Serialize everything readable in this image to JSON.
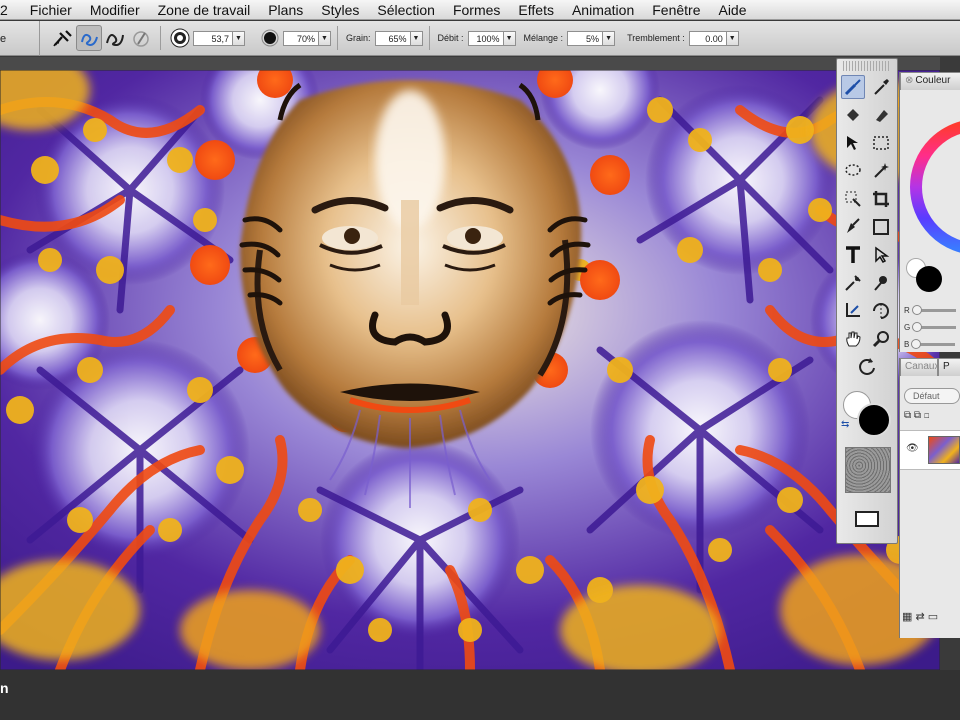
{
  "menubar": {
    "items": [
      "2",
      "Fichier",
      "Modifier",
      "Zone de travail",
      "Plans",
      "Styles",
      "Sélection",
      "Formes",
      "Effets",
      "Animation",
      "Fenêtre",
      "Aide"
    ]
  },
  "propbar": {
    "stub_label": "e",
    "size_value": "53,7",
    "opacity_value": "70%",
    "grain_label": "Grain:",
    "grain_value": "65%",
    "debit_label": "Débit :",
    "debit_value": "100%",
    "melange_label": "Mélange :",
    "melange_value": "5%",
    "tremblement_label": "Tremblement :",
    "tremblement_value": "0.00"
  },
  "panels": {
    "color_tab": "Couleur",
    "layers_tab_1": "Canaux",
    "layers_tab_2": "P",
    "blend_mode": "Défaut",
    "rgb_labels": [
      "R",
      "G",
      "B"
    ]
  },
  "bottom": {
    "corner_text": "n"
  },
  "colors": {
    "foreground": "#000000",
    "background": "#ffffff",
    "artwork_orange": "#f04a12",
    "artwork_yellow": "#f0b21c",
    "artwork_purple": "#4a1f9a"
  }
}
